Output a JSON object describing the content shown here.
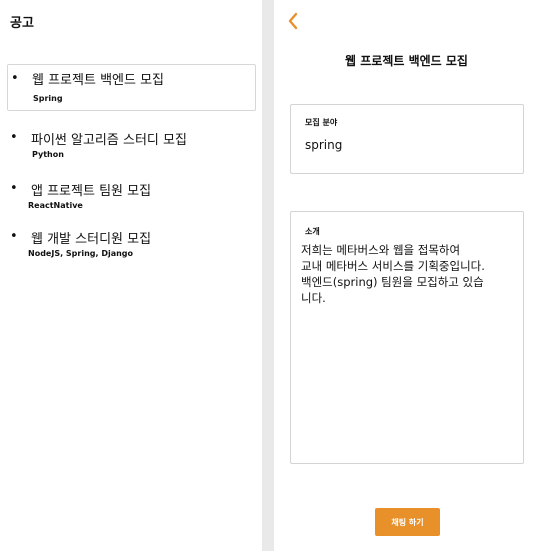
{
  "sidebar": {
    "title": "공고",
    "posts": [
      {
        "title": "웹 프로젝트 백엔드 모집",
        "tags": "Spring"
      },
      {
        "title": "파이썬 알고리즘 스터디 모집",
        "tags": "Python"
      },
      {
        "title": "앱 프로젝트 팀원 모집",
        "tags": "ReactNative"
      },
      {
        "title": "웹 개발 스터디원 모집",
        "tags": "NodeJS, Spring, Django"
      }
    ],
    "bullet": "•"
  },
  "detail": {
    "back_icon": "chevron-left-icon",
    "title": "웹 프로젝트 백엔드 모집",
    "field_label": "모집 분야",
    "field_value": "spring",
    "intro_label": "소개",
    "intro_text": "저희는 메타버스와 웹을 접목하여\n교내 메타버스 서비스를 기획중입니다.\n백엔드(spring) 팀원을 모집하고 있습\n니다.",
    "chat_button": "채팅 하기"
  },
  "colors": {
    "accent": "#e8912a",
    "divider": "#e9e9e9",
    "border": "#d4d4d4"
  }
}
